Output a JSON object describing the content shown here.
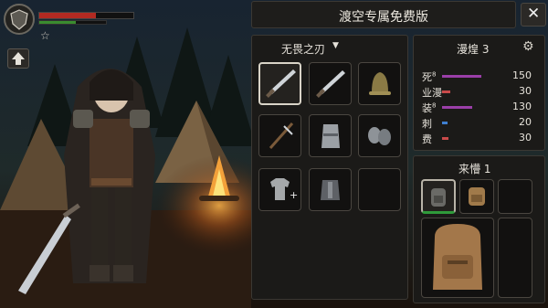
{
  "header": {
    "title": "渡空专属免费版",
    "close_icon": "close-icon"
  },
  "hud": {
    "health_fraction": 0.6,
    "mana_fraction": 0.55,
    "rank_stars": 1,
    "colors": {
      "health": "#b22a22",
      "mana": "#3a8c2f"
    }
  },
  "equipment": {
    "dropdown_label": "无畏之刃",
    "slots": [
      {
        "icon": "dagger-icon",
        "selected": true
      },
      {
        "icon": "dagger-icon",
        "selected": false
      },
      {
        "icon": "bell-helmet-icon",
        "selected": false
      },
      {
        "icon": "crossbow-icon",
        "selected": false
      },
      {
        "icon": "gauntlet-icon",
        "selected": false
      },
      {
        "icon": "chain-gloves-icon",
        "selected": false
      },
      {
        "icon": "add-shirt-icon",
        "selected": false
      },
      {
        "icon": "chest-armor-icon",
        "selected": false
      },
      {
        "icon": "empty-slot",
        "selected": false
      }
    ]
  },
  "stats": {
    "title": "漫煌 3",
    "settings_icon": "gear-icon",
    "rows": [
      {
        "name": "死",
        "sup": "8",
        "value": "150",
        "fraction": 0.72,
        "color": "#9a3fa8"
      },
      {
        "name": "业漫",
        "value": "30",
        "fraction": 0.15,
        "color": "#c94a4a"
      },
      {
        "name": "装",
        "sup": "8",
        "value": "130",
        "fraction": 0.55,
        "color": "#9a3fa8"
      },
      {
        "name": "刺",
        "value": "20",
        "fraction": 0.1,
        "color": "#3f7fd0"
      },
      {
        "name": "费",
        "value": "30",
        "fraction": 0.12,
        "color": "#c94a4a"
      }
    ]
  },
  "inventory": {
    "title": "来懵 1",
    "items": [
      {
        "icon": "small-backpack-icon",
        "selected": true
      },
      {
        "icon": "small-backpack-icon",
        "selected": false
      },
      {
        "icon": "large-backpack-icon",
        "selected": false
      }
    ]
  },
  "home_icon": "up-arrow-icon"
}
